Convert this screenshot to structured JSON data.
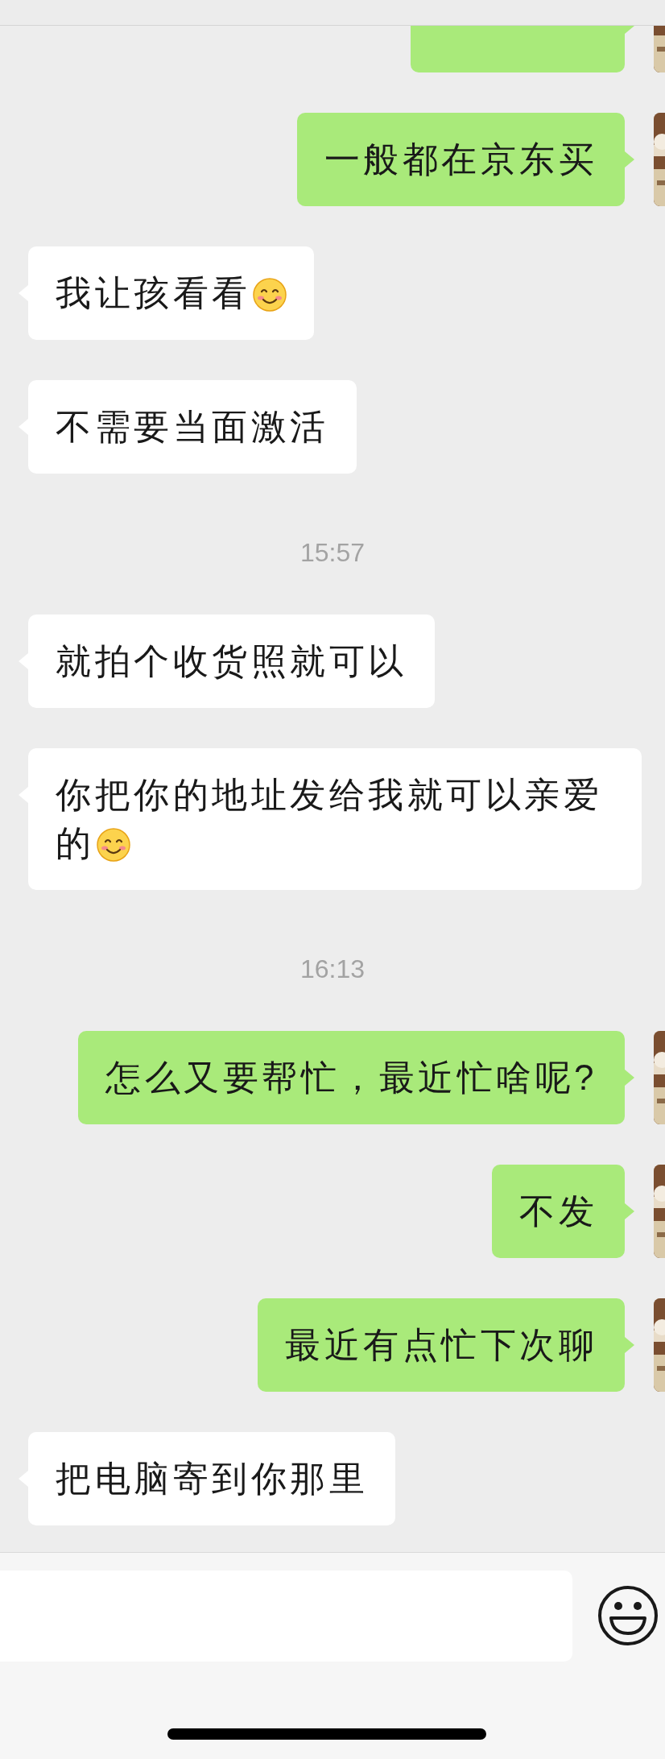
{
  "messages": [
    {
      "kind": "clipped",
      "outgoing": true
    },
    {
      "kind": "message",
      "outgoing": true,
      "text": "一般都在京东买",
      "smiley": false
    },
    {
      "kind": "message",
      "outgoing": false,
      "text": "我让孩看看",
      "smiley": true
    },
    {
      "kind": "message",
      "outgoing": false,
      "text": "不需要当面激活",
      "smiley": false
    },
    {
      "kind": "time",
      "text": "15:57"
    },
    {
      "kind": "message",
      "outgoing": false,
      "text": "就拍个收货照就可以",
      "smiley": false
    },
    {
      "kind": "message",
      "outgoing": false,
      "text": "你把你的地址发给我就可以亲爱的",
      "smiley": true
    },
    {
      "kind": "time",
      "text": "16:13"
    },
    {
      "kind": "message",
      "outgoing": true,
      "text": "怎么又要帮忙，最近忙啥呢?",
      "smiley": false
    },
    {
      "kind": "message",
      "outgoing": true,
      "text": "不发",
      "smiley": false
    },
    {
      "kind": "message",
      "outgoing": true,
      "text": "最近有点忙下次聊",
      "smiley": false
    },
    {
      "kind": "message",
      "outgoing": false,
      "text": "把电脑寄到你那里",
      "smiley": false
    }
  ]
}
